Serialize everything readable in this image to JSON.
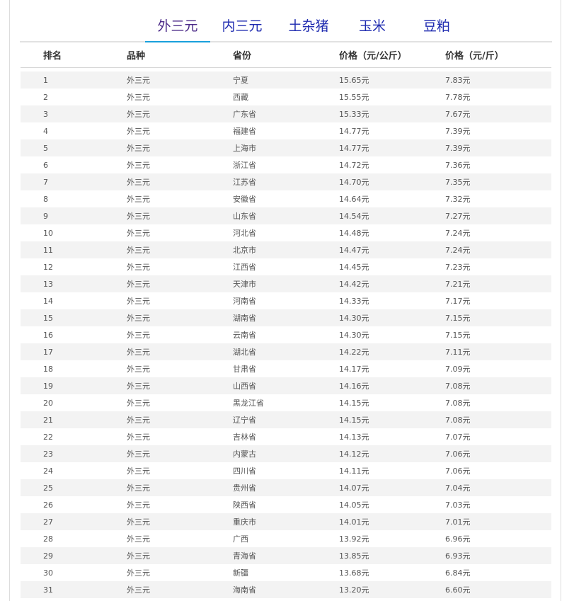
{
  "tabs": [
    {
      "label": "外三元",
      "active": true
    },
    {
      "label": "内三元",
      "active": false
    },
    {
      "label": "土杂猪",
      "active": false
    },
    {
      "label": "玉米",
      "active": false
    },
    {
      "label": "豆粕",
      "active": false
    }
  ],
  "table": {
    "headers": [
      "排名",
      "品种",
      "省份",
      "价格（元/公斤）",
      "价格（元/斤）"
    ],
    "rows": [
      [
        "1",
        "外三元",
        "宁夏",
        "15.65元",
        "7.83元"
      ],
      [
        "2",
        "外三元",
        "西藏",
        "15.55元",
        "7.78元"
      ],
      [
        "3",
        "外三元",
        "广东省",
        "15.33元",
        "7.67元"
      ],
      [
        "4",
        "外三元",
        "福建省",
        "14.77元",
        "7.39元"
      ],
      [
        "5",
        "外三元",
        "上海市",
        "14.77元",
        "7.39元"
      ],
      [
        "6",
        "外三元",
        "浙江省",
        "14.72元",
        "7.36元"
      ],
      [
        "7",
        "外三元",
        "江苏省",
        "14.70元",
        "7.35元"
      ],
      [
        "8",
        "外三元",
        "安徽省",
        "14.64元",
        "7.32元"
      ],
      [
        "9",
        "外三元",
        "山东省",
        "14.54元",
        "7.27元"
      ],
      [
        "10",
        "外三元",
        "河北省",
        "14.48元",
        "7.24元"
      ],
      [
        "11",
        "外三元",
        "北京市",
        "14.47元",
        "7.24元"
      ],
      [
        "12",
        "外三元",
        "江西省",
        "14.45元",
        "7.23元"
      ],
      [
        "13",
        "外三元",
        "天津市",
        "14.42元",
        "7.21元"
      ],
      [
        "14",
        "外三元",
        "河南省",
        "14.33元",
        "7.17元"
      ],
      [
        "15",
        "外三元",
        "湖南省",
        "14.30元",
        "7.15元"
      ],
      [
        "16",
        "外三元",
        "云南省",
        "14.30元",
        "7.15元"
      ],
      [
        "17",
        "外三元",
        "湖北省",
        "14.22元",
        "7.11元"
      ],
      [
        "18",
        "外三元",
        "甘肃省",
        "14.17元",
        "7.09元"
      ],
      [
        "19",
        "外三元",
        "山西省",
        "14.16元",
        "7.08元"
      ],
      [
        "20",
        "外三元",
        "黑龙江省",
        "14.15元",
        "7.08元"
      ],
      [
        "21",
        "外三元",
        "辽宁省",
        "14.15元",
        "7.08元"
      ],
      [
        "22",
        "外三元",
        "吉林省",
        "14.13元",
        "7.07元"
      ],
      [
        "23",
        "外三元",
        "内蒙古",
        "14.12元",
        "7.06元"
      ],
      [
        "24",
        "外三元",
        "四川省",
        "14.11元",
        "7.06元"
      ],
      [
        "25",
        "外三元",
        "贵州省",
        "14.07元",
        "7.04元"
      ],
      [
        "26",
        "外三元",
        "陕西省",
        "14.05元",
        "7.03元"
      ],
      [
        "27",
        "外三元",
        "重庆市",
        "14.01元",
        "7.01元"
      ],
      [
        "28",
        "外三元",
        "广西",
        "13.92元",
        "6.96元"
      ],
      [
        "29",
        "外三元",
        "青海省",
        "13.85元",
        "6.93元"
      ],
      [
        "30",
        "外三元",
        "新疆",
        "13.68元",
        "6.84元"
      ],
      [
        "31",
        "外三元",
        "海南省",
        "13.20元",
        "6.60元"
      ]
    ]
  },
  "colors": {
    "tab_text": "#1f2bb0",
    "tab_active_text": "#4b2a88",
    "tab_underline": "#1aa0dc",
    "row_stripe": "#f3f3f3"
  }
}
